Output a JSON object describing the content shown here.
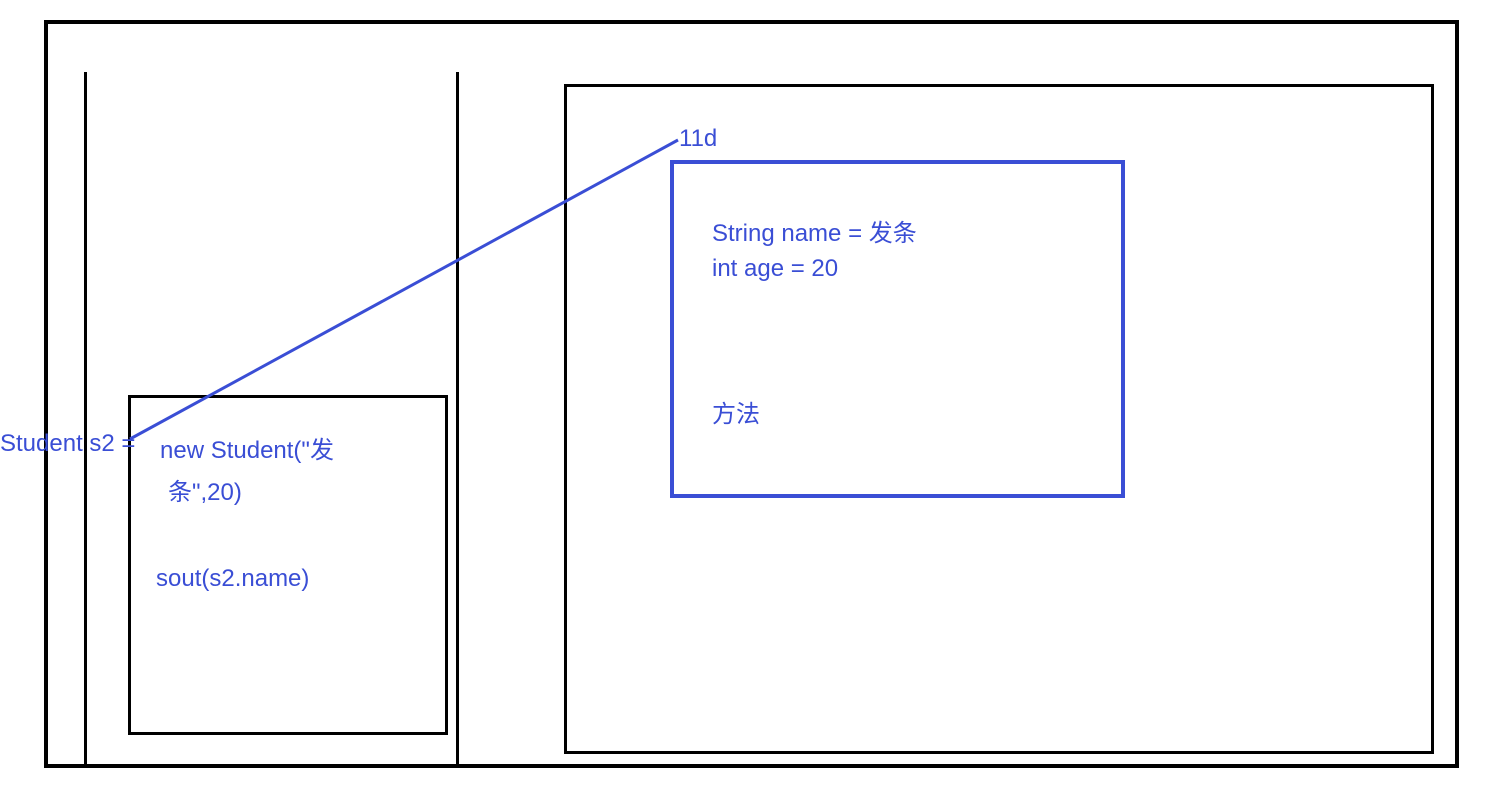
{
  "diagram": {
    "stack": {
      "variable_declaration": "Student s2 =",
      "code_line1": "new Student(\"发",
      "code_line2": "条\",20)",
      "code_line3": "sout(s2.name)"
    },
    "heap": {
      "address": "11d",
      "field_name": "String name = 发条",
      "field_age": "int age =  20",
      "methods_label": "方法"
    }
  }
}
